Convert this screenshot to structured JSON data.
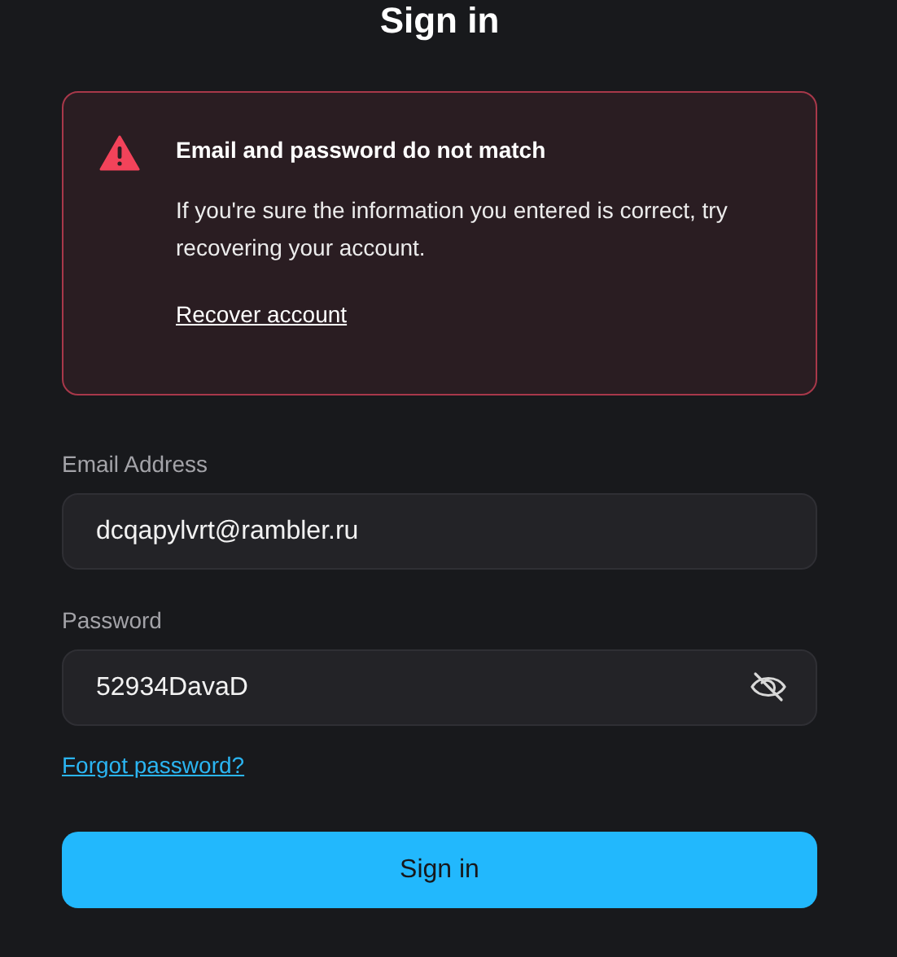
{
  "title": "Sign in",
  "alert": {
    "heading": "Email and password do not match",
    "message": "If you're sure the information you entered is correct, try recovering your account.",
    "link": "Recover account"
  },
  "fields": [
    {
      "label": "Email Address",
      "value": "dcqapylvrt@rambler.ru",
      "kind": "email"
    },
    {
      "label": "Password",
      "value": "52934DavaD",
      "kind": "password",
      "revealed": true
    }
  ],
  "forgot_link": "Forgot password?",
  "submit": "Sign in"
}
